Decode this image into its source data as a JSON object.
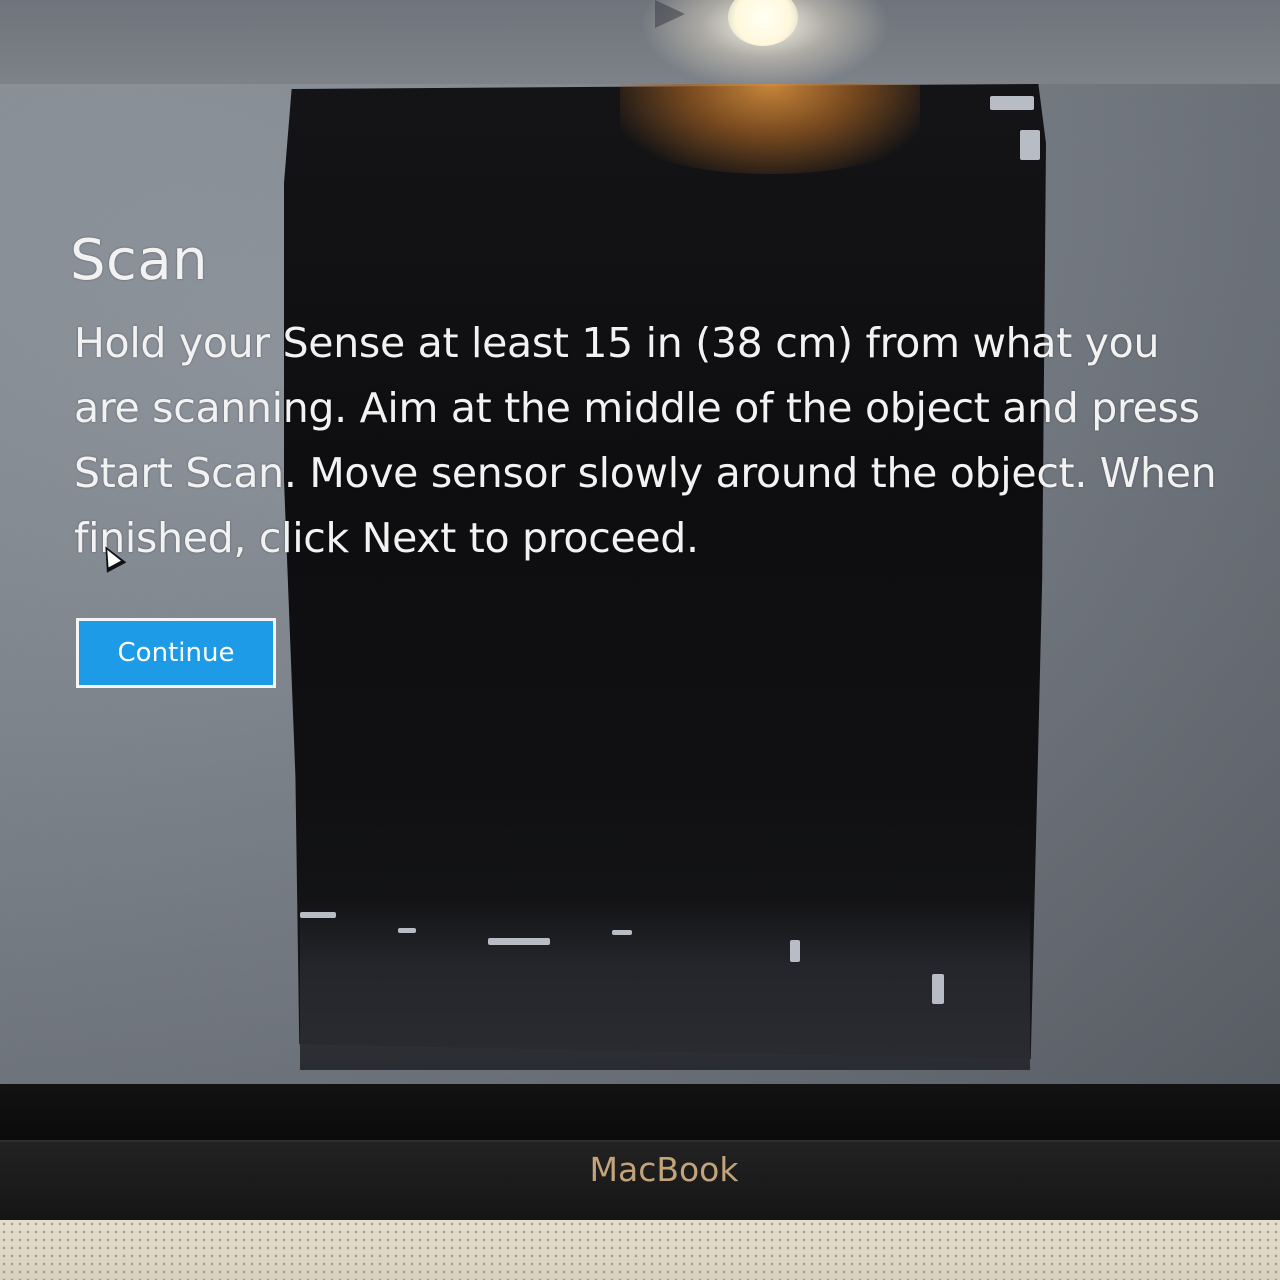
{
  "app": {
    "title": "Scan",
    "instructions": "Hold your Sense at least 15 in (38 cm) from what you are scanning. Aim at the middle of the object and press Start Scan. Move sensor slowly around the object. When finished, click Next to proceed.",
    "continue_label": "Continue"
  },
  "device": {
    "brand": "MacBook"
  },
  "colors": {
    "button_fill": "#1e9be6",
    "button_border": "#f4f4f4",
    "text": "#f2f2f2",
    "brand_text": "#c3a47a"
  },
  "icons": [
    "play-icon",
    "mouse-cursor-icon"
  ]
}
